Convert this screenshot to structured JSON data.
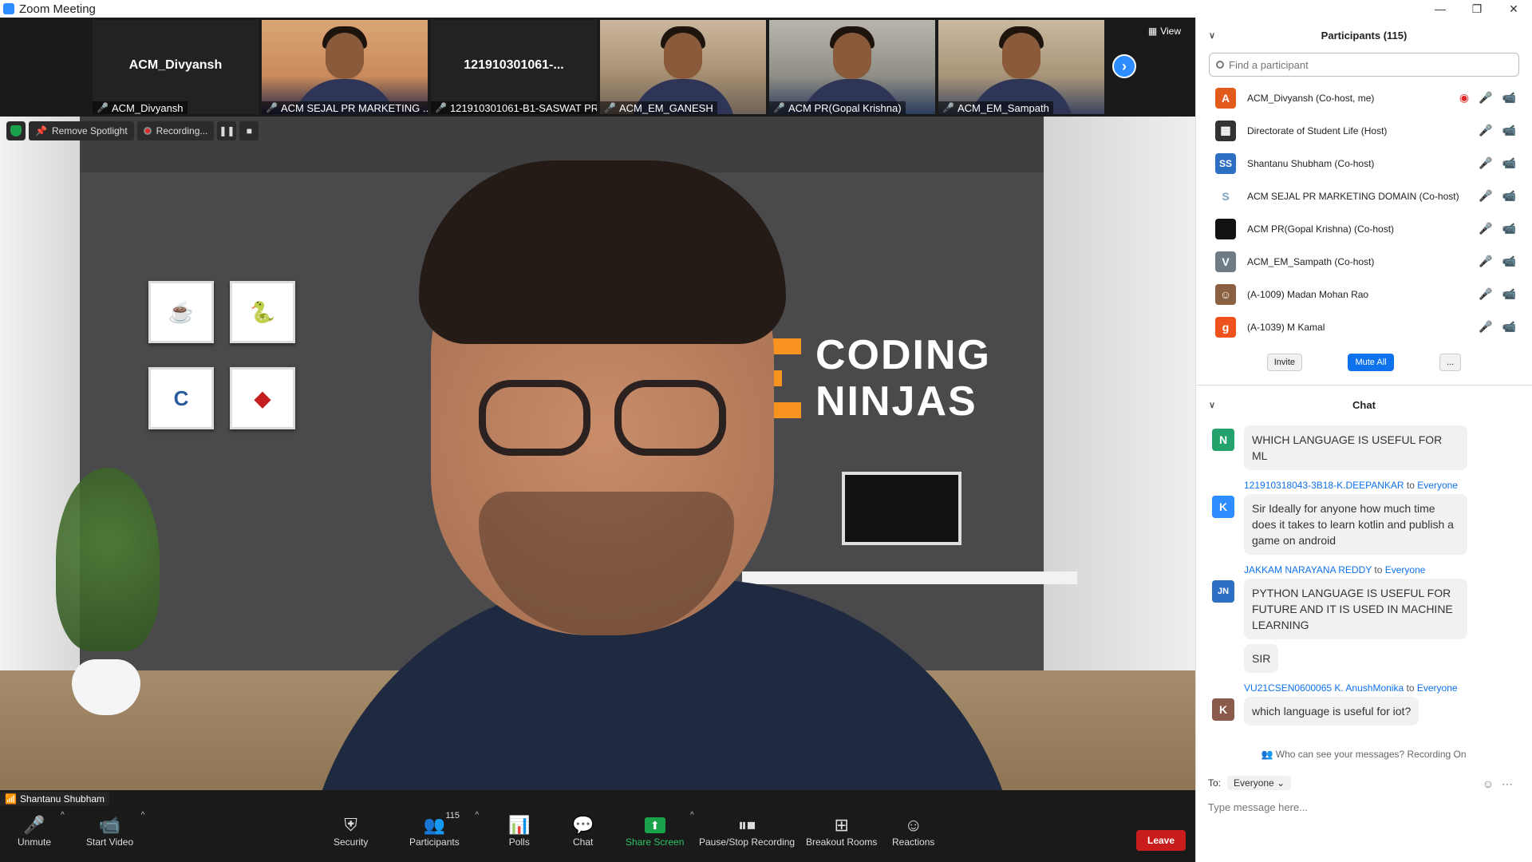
{
  "window": {
    "title": "Zoom Meeting",
    "minimize": "—",
    "maximize": "❐",
    "close": "✕"
  },
  "strip": {
    "thumbs": [
      {
        "label": "ACM_Divyansh",
        "big": "ACM_Divyansh"
      },
      {
        "label": "ACM  SEJAL PR MARKETING ...",
        "big": ""
      },
      {
        "label": "121910301061-B1-SASWAT PR...",
        "big": "121910301061-..."
      },
      {
        "label": "ACM_EM_GANESH",
        "big": ""
      },
      {
        "label": "ACM PR(Gopal Krishna)",
        "big": ""
      },
      {
        "label": "ACM_EM_Sampath",
        "big": ""
      }
    ],
    "view_label": "View"
  },
  "spotlight": {
    "remove_label": "Remove Spotlight",
    "recording_label": "Recording..."
  },
  "speaker_name": "Shantanu Shubham",
  "background_brand": {
    "line1": "CODING",
    "line2": "NINJAS"
  },
  "toolbar": {
    "unmute": "Unmute",
    "start_video": "Start Video",
    "security": "Security",
    "participants": "Participants",
    "participants_count": "115",
    "polls": "Polls",
    "chat": "Chat",
    "share_screen": "Share Screen",
    "pause_stop": "Pause/Stop Recording",
    "breakout": "Breakout Rooms",
    "reactions": "Reactions",
    "leave": "Leave"
  },
  "participants_panel": {
    "title": "Participants (115)",
    "search_placeholder": "Find a participant",
    "people": [
      {
        "name": "ACM_Divyansh (Co-host, me)",
        "avatar": "A",
        "color": "#e25a1c"
      },
      {
        "name": "Directorate of Student Life (Host)",
        "avatar": "▦",
        "color": "#333333"
      },
      {
        "name": "Shantanu Shubham (Co-host)",
        "avatar": "SS",
        "color": "#2d6fc2"
      },
      {
        "name": "ACM  SEJAL PR MARKETING DOMAIN (Co-host)",
        "avatar": "S",
        "color": "#ffffff"
      },
      {
        "name": "ACM PR(Gopal Krishna) (Co-host)",
        "avatar": "",
        "color": "#111111"
      },
      {
        "name": "ACM_EM_Sampath (Co-host)",
        "avatar": "V",
        "color": "#6f7c86"
      },
      {
        "name": "(A-1009) Madan Mohan Rao",
        "avatar": "☺",
        "color": "#8a6040"
      },
      {
        "name": "(A-1039) M Kamal",
        "avatar": "g",
        "color": "#f0521e"
      }
    ],
    "invite": "Invite",
    "mute_all": "Mute All",
    "more": "..."
  },
  "chat": {
    "title": "Chat",
    "messages": [
      {
        "avatar": "N",
        "color": "#23a36b",
        "sender": "",
        "to": "",
        "bubbles": [
          "WHICH LANGUAGE IS USEFUL FOR ML"
        ]
      },
      {
        "avatar": "K",
        "color": "#2d8cff",
        "sender": "121910318043-3B18-K.DEEPANKAR",
        "to": "Everyone",
        "bubbles": [
          "Sir Ideally for anyone how much time does it takes to learn kotlin and publish a game on android"
        ]
      },
      {
        "avatar": "JN",
        "color": "#2d6fc2",
        "sender": "JAKKAM NARAYANA REDDY",
        "to": "Everyone",
        "bubbles": [
          "PYTHON LANGUAGE IS USEFUL FOR FUTURE AND IT IS USED IN MACHINE LEARNING",
          "SIR"
        ]
      },
      {
        "avatar": "K",
        "color": "#8a5a4a",
        "sender": "VU21CSEN0600065 K. AnushMonika",
        "to": "Everyone",
        "bubbles": [
          "which language is useful for iot?"
        ]
      }
    ],
    "to_word": "to",
    "visibility_note": "Who can see your messages? Recording On",
    "to_label": "To:",
    "to_value": "Everyone",
    "input_placeholder": "Type message here..."
  }
}
